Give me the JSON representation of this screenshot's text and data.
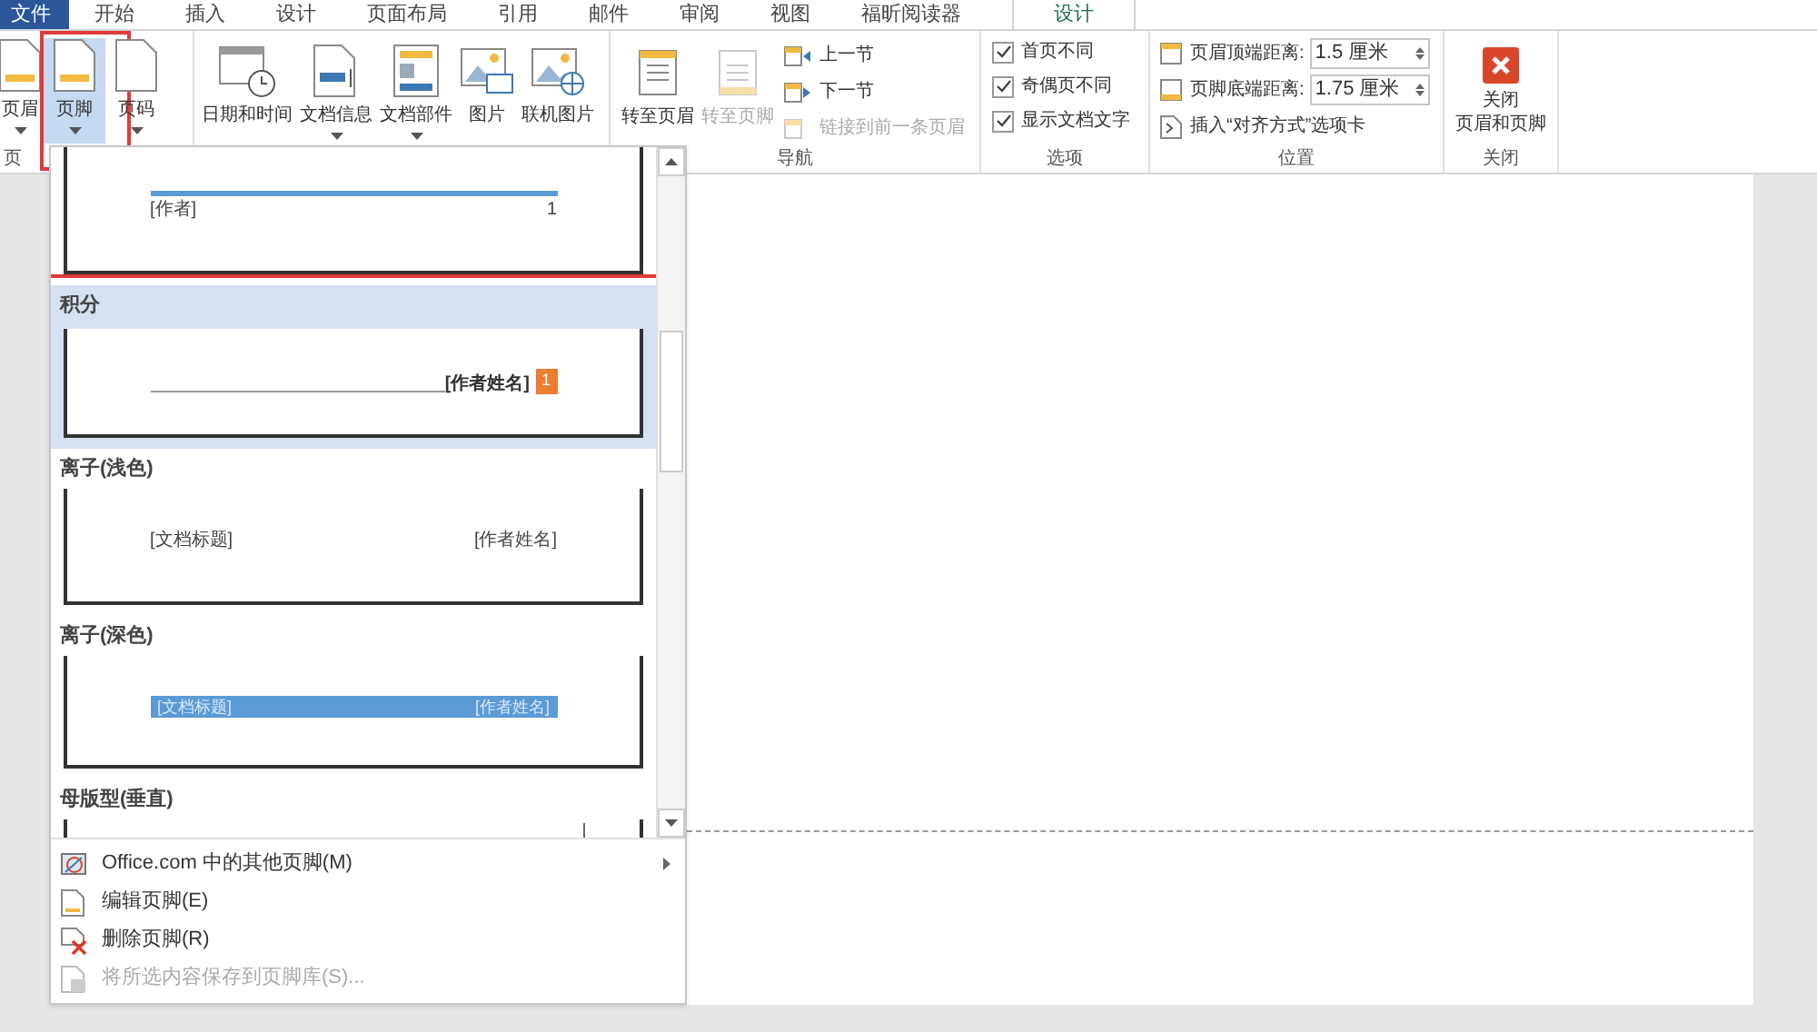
{
  "tabs": [
    {
      "label": "文件",
      "kind": "file",
      "selected": false
    },
    {
      "label": "开始",
      "kind": "tab",
      "selected": false
    },
    {
      "label": "插入",
      "kind": "tab",
      "selected": false
    },
    {
      "label": "设计",
      "kind": "tab",
      "selected": false
    },
    {
      "label": "页面布局",
      "kind": "tab",
      "selected": false
    },
    {
      "label": "引用",
      "kind": "tab",
      "selected": false
    },
    {
      "label": "邮件",
      "kind": "tab",
      "selected": false
    },
    {
      "label": "审阅",
      "kind": "tab",
      "selected": false
    },
    {
      "label": "视图",
      "kind": "tab",
      "selected": false
    },
    {
      "label": "福昕阅读器",
      "kind": "tab",
      "selected": false
    },
    {
      "label": "设计",
      "kind": "contextual",
      "selected": true
    }
  ],
  "ribbon": {
    "header_footer": {
      "label": "页",
      "buttons": [
        {
          "label": "页眉",
          "selected": false,
          "highlighted": false
        },
        {
          "label": "页脚",
          "selected": true,
          "highlighted": true
        },
        {
          "label": "页码",
          "selected": false,
          "highlighted": false
        }
      ]
    },
    "insert": [
      {
        "label": "日期和时间",
        "dropdown": false
      },
      {
        "label": "文档信息",
        "dropdown": true
      },
      {
        "label": "文档部件",
        "dropdown": true
      },
      {
        "label": "图片",
        "dropdown": false
      },
      {
        "label": "联机图片",
        "dropdown": false
      }
    ],
    "navigation": {
      "label": "导航",
      "large": [
        {
          "label": "转至页眉",
          "disabled": false
        },
        {
          "label": "转至页脚",
          "disabled": true
        }
      ],
      "small": [
        {
          "label": "上一节",
          "disabled": false
        },
        {
          "label": "下一节",
          "disabled": false
        },
        {
          "label": "链接到前一条页眉",
          "disabled": true
        }
      ]
    },
    "options": {
      "label": "选项",
      "items": [
        {
          "label": "首页不同",
          "checked": true
        },
        {
          "label": "奇偶页不同",
          "checked": true
        },
        {
          "label": "显示文档文字",
          "checked": true
        }
      ]
    },
    "position": {
      "label": "位置",
      "fields": [
        {
          "label": "页眉顶端距离:",
          "value": "1.5 厘米"
        },
        {
          "label": "页脚底端距离:",
          "value": "1.75 厘米"
        }
      ],
      "insert_tab": "插入“对齐方式”选项卡"
    },
    "close": {
      "label": "关闭",
      "button": [
        "关闭",
        "页眉和页脚"
      ]
    }
  },
  "gallery": {
    "items": [
      {
        "kind": "line",
        "selected": false,
        "highlighted": false,
        "texts": [
          "[作者]",
          "1"
        ]
      },
      {
        "kind": "score",
        "title": "积分",
        "selected": true,
        "highlighted": true,
        "texts": [
          "[作者姓名]",
          "1"
        ]
      },
      {
        "kind": "plain",
        "title": "离子(浅色)",
        "selected": false,
        "highlighted": false,
        "texts": [
          "[文档标题]",
          "[作者姓名]"
        ]
      },
      {
        "kind": "band",
        "title": "离子(深色)",
        "selected": false,
        "highlighted": false,
        "texts": [
          "[文档标题]",
          "[作者姓名]"
        ]
      },
      {
        "kind": "cut",
        "title": "母版型(垂直)",
        "selected": false,
        "highlighted": false
      }
    ]
  },
  "menu": [
    {
      "label": "Office.com 中的其他页脚(M)",
      "submenu": true,
      "disabled": false
    },
    {
      "label": "编辑页脚(E)",
      "submenu": false,
      "disabled": false
    },
    {
      "label": "删除页脚(R)",
      "submenu": false,
      "disabled": false
    },
    {
      "label": "将所选内容保存到页脚库(S)...",
      "submenu": false,
      "disabled": true
    }
  ]
}
